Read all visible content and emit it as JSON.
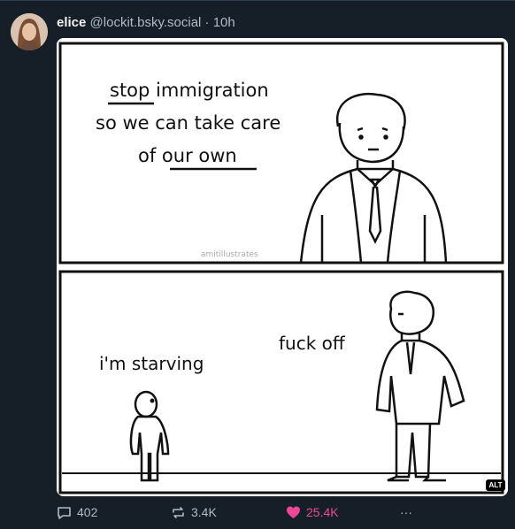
{
  "post": {
    "display_name": "elice",
    "handle": "@lockit.bsky.social",
    "separator": "·",
    "time": "10h"
  },
  "comic": {
    "panel1_lines": [
      "stop immigration",
      "so we can take care",
      "of our own"
    ],
    "watermark": "amitillustrates",
    "panel2_child": "i'm starving",
    "panel2_man": "fuck off"
  },
  "alt_badge": "ALT",
  "actions": {
    "replies": "402",
    "reposts": "3.4K",
    "likes": "25.4K",
    "more": "···"
  },
  "colors": {
    "background": "#161e27",
    "text_secondary": "#aebbc9",
    "like_active": "#ec4899"
  },
  "icons": [
    "reply-icon",
    "repost-icon",
    "heart-icon",
    "more-icon"
  ]
}
